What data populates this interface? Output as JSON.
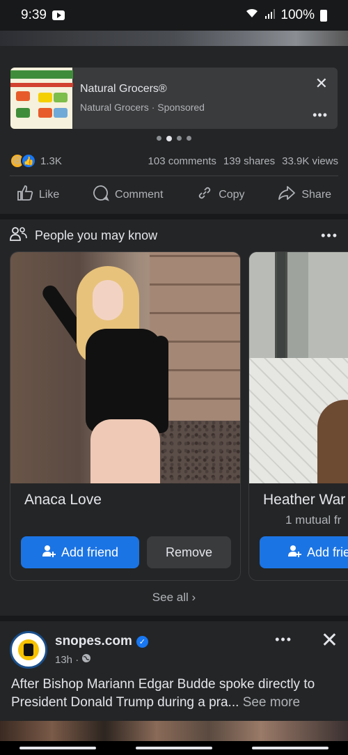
{
  "status": {
    "time": "9:39",
    "battery": "100%"
  },
  "ad": {
    "title": "Natural Grocers®",
    "subtitle": "Natural Grocers · Sponsored",
    "carousel_index": 2,
    "carousel_total": 4
  },
  "stats": {
    "reactions": "1.3K",
    "comments": "103 comments",
    "shares": "139 shares",
    "views": "33.9K views",
    "reaction_icons": [
      "haha-icon",
      "like-icon"
    ]
  },
  "actions": {
    "like": "Like",
    "comment": "Comment",
    "copy": "Copy",
    "share": "Share"
  },
  "pymk": {
    "title": "People you may know",
    "cards": [
      {
        "name": "Anaca Love",
        "add_label": "Add friend",
        "remove_label": "Remove"
      },
      {
        "name": "Heather War",
        "mutual": "1 mutual fr",
        "add_label": "Add frie"
      }
    ],
    "see_all": "See all"
  },
  "post2": {
    "page_name": "snopes.com",
    "time": "13h ·",
    "text": "After Bishop Mariann Edgar Budde spoke directly to President Donald Trump during a pra...",
    "see_more": "See more"
  },
  "colors": {
    "accent": "#1b74e4",
    "background": "#242526",
    "separator": "#18191a"
  }
}
